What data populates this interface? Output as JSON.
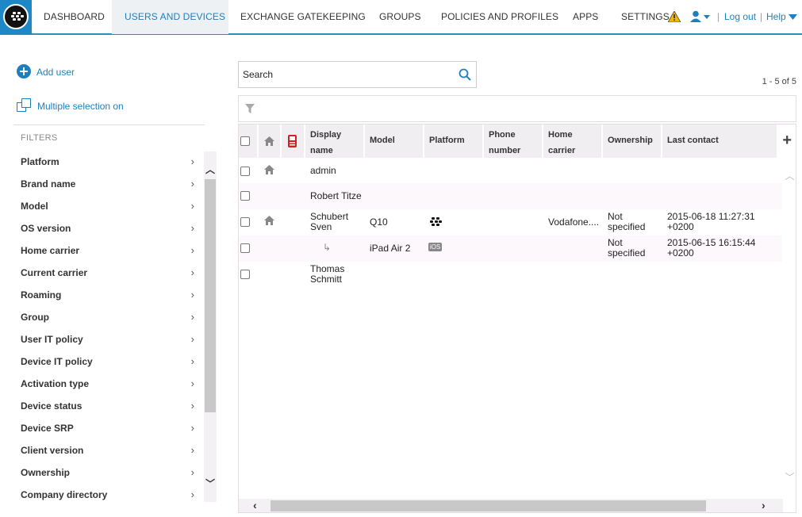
{
  "nav": {
    "items": [
      "DASHBOARD",
      "USERS AND DEVICES",
      "EXCHANGE GATEKEEPING",
      "GROUPS",
      "POLICIES AND PROFILES",
      "APPS",
      "SETTINGS"
    ],
    "active": "USERS AND DEVICES",
    "logout": "Log out",
    "help": "Help",
    "sep": "|"
  },
  "left": {
    "add_user": "Add user",
    "multiple_selection": "Multiple selection on",
    "filters_title": "FILTERS",
    "filters": [
      "Platform",
      "Brand name",
      "Model",
      "OS version",
      "Home carrier",
      "Current carrier",
      "Roaming",
      "Group",
      "User IT policy",
      "Device IT policy",
      "Activation type",
      "Device status",
      "Device SRP",
      "Client version",
      "Ownership",
      "Company directory"
    ]
  },
  "search": {
    "placeholder": "Search",
    "value": "Search"
  },
  "pager": "1 - 5 of 5",
  "table": {
    "headers": {
      "display_name_1": "Display",
      "display_name_2": "name",
      "model": "Model",
      "platform": "Platform",
      "phone_1": "Phone",
      "phone_2": "number",
      "home_1": "Home",
      "home_2": "carrier",
      "ownership": "Ownership",
      "last_contact": "Last contact"
    },
    "rows": [
      {
        "name": "admin",
        "model": "",
        "home": "",
        "own1": "",
        "own2": "",
        "lc1": "",
        "lc2": ""
      },
      {
        "name": "Robert Titze",
        "model": "",
        "home": "",
        "own1": "",
        "own2": "",
        "lc1": "",
        "lc2": ""
      },
      {
        "name1": "Schubert",
        "name2": "Sven",
        "model": "Q10",
        "home": "Vodafone....",
        "own1": "Not",
        "own2": "specified",
        "lc1": "2015-06-18 11:27:31",
        "lc2": "+0200"
      },
      {
        "name": "",
        "model": "iPad Air 2",
        "platform_badge": "iOS",
        "home": "",
        "own1": "Not",
        "own2": "specified",
        "lc1": "2015-06-15 16:15:44",
        "lc2": "+0200"
      },
      {
        "name1": "Thomas",
        "name2": "Schmitt",
        "model": "",
        "home": "",
        "own1": "",
        "own2": "",
        "lc1": "",
        "lc2": ""
      }
    ]
  },
  "colors": {
    "accent": "#1e7fbf",
    "header_bg": "#f1eef1",
    "logo_bg": "#1e88c7"
  }
}
